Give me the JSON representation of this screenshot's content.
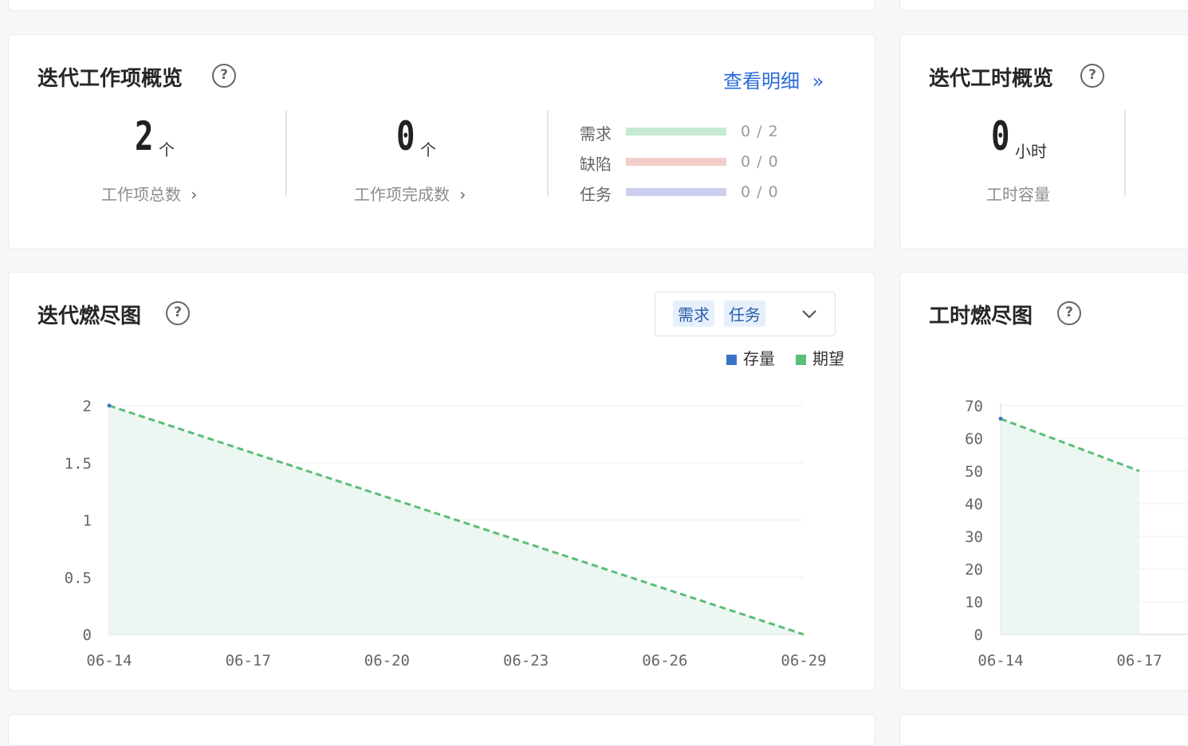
{
  "overview": {
    "title": "迭代工作项概览",
    "help_icon": "?",
    "detail_link": "查看明细",
    "detail_icon": "»",
    "total": {
      "value": "2",
      "unit": "个",
      "label": "工作项总数"
    },
    "done": {
      "value": "0",
      "unit": "个",
      "label": "工作项完成数"
    },
    "chevron_icon": "›",
    "bars": [
      {
        "label": "需求",
        "value": "0 / 2",
        "color": "#c6ead2"
      },
      {
        "label": "缺陷",
        "value": "0 / 0",
        "color": "#f2cdc9"
      },
      {
        "label": "任务",
        "value": "0 / 0",
        "color": "#cdcdf0"
      }
    ]
  },
  "hours_overview": {
    "title": "迭代工时概览",
    "help_icon": "?",
    "capacity": {
      "value": "0",
      "unit": "小时",
      "label": "工时容量"
    }
  },
  "burndown": {
    "title": "迭代燃尽图",
    "help_icon": "?",
    "filter_tags": [
      "需求",
      "任务"
    ],
    "legend": [
      {
        "label": "存量",
        "color": "#3b73c9"
      },
      {
        "label": "期望",
        "color": "#5cbd7a"
      }
    ]
  },
  "hours_burndown": {
    "title": "工时燃尽图",
    "help_icon": "?"
  },
  "chart_data": [
    {
      "type": "line",
      "title": "",
      "x": [
        "06-14",
        "06-17",
        "06-20",
        "06-23",
        "06-26",
        "06-29"
      ],
      "ylim": [
        0,
        2
      ],
      "yticks": [
        "2",
        "1.5",
        "1",
        "0.5",
        "0"
      ],
      "series": [
        {
          "name": "存量",
          "values": [
            2
          ]
        },
        {
          "name": "期望",
          "values": [
            2,
            1.6,
            1.2,
            0.8,
            0.4,
            0
          ]
        }
      ],
      "grid": true
    },
    {
      "type": "line",
      "title": "",
      "x": [
        "06-14",
        "06-17"
      ],
      "ylim": [
        0,
        70
      ],
      "yticks": [
        "70",
        "60",
        "50",
        "40",
        "30",
        "20",
        "10",
        "0"
      ],
      "series": [
        {
          "name": "期望",
          "values": [
            66,
            50
          ]
        }
      ],
      "grid": true
    }
  ]
}
